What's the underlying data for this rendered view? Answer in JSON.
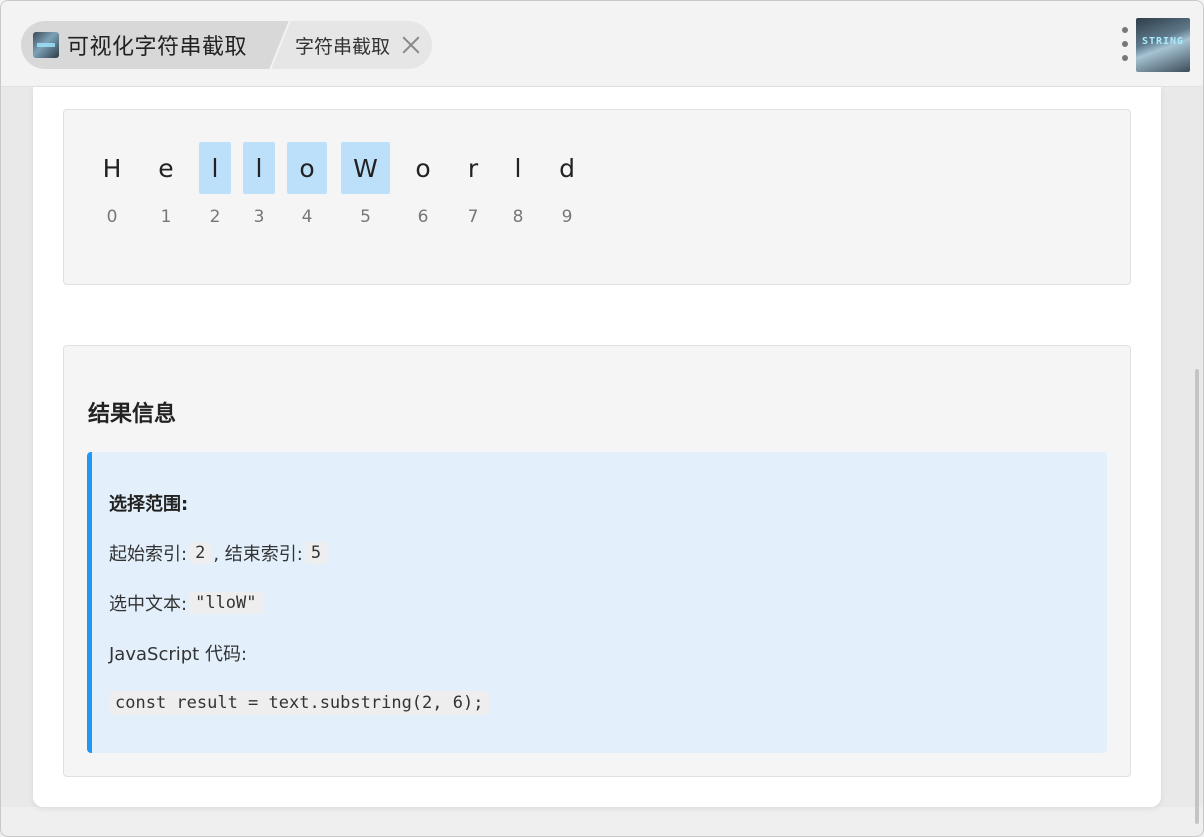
{
  "window": {
    "tab_main_title": "可视化字符串截取",
    "tab_sub_title": "字符串截取",
    "thumb_text": "STRING",
    "bottom_text": "• ———"
  },
  "chars": {
    "items": [
      {
        "char": "H",
        "index": "0",
        "selected": false
      },
      {
        "char": "e",
        "index": "1",
        "selected": false
      },
      {
        "char": "l",
        "index": "2",
        "selected": true
      },
      {
        "char": "l",
        "index": "3",
        "selected": true
      },
      {
        "char": "o",
        "index": "4",
        "selected": true
      },
      {
        "char": "W",
        "index": "5",
        "selected": true
      },
      {
        "char": "o",
        "index": "6",
        "selected": false
      },
      {
        "char": "r",
        "index": "7",
        "selected": false
      },
      {
        "char": "l",
        "index": "8",
        "selected": false
      },
      {
        "char": "d",
        "index": "9",
        "selected": false
      }
    ]
  },
  "result": {
    "title": "结果信息",
    "range_label": "选择范围:",
    "start_label": "起始索引: ",
    "start_value": "2",
    "end_label": ", 结束索引: ",
    "end_value": "5",
    "selected_label": "选中文本: ",
    "selected_value": "\"lloW\"",
    "js_label": "JavaScript 代码:",
    "code": "const result = text.substring(2, 6);"
  },
  "colors": {
    "selected_bg": "#bde0fa",
    "accent": "#2196f3",
    "info_bg": "#e3f0fb"
  }
}
